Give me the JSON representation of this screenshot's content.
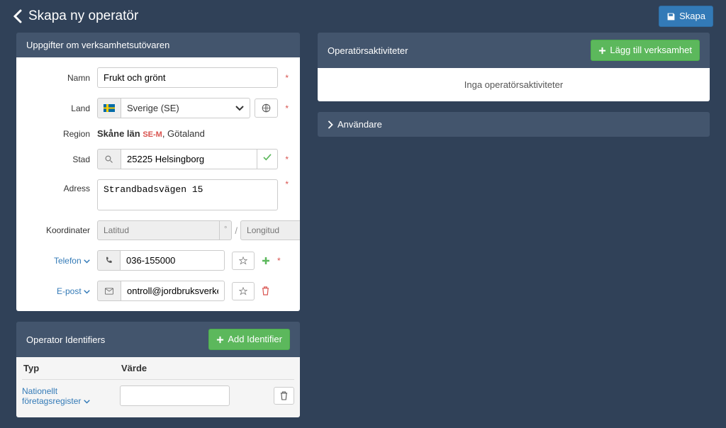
{
  "pageTitle": "Skapa ny operatör",
  "createBtn": "Skapa",
  "detailsPanel": {
    "title": "Uppgifter om verksamhetsutövaren",
    "labels": {
      "name": "Namn",
      "country": "Land",
      "region": "Region",
      "city": "Stad",
      "address": "Adress",
      "coords": "Koordinater",
      "phone": "Telefon",
      "email": "E-post"
    },
    "values": {
      "name": "Frukt och grönt",
      "country": "Sverige (SE)",
      "region_main": "Skåne län",
      "region_code": "SE-M",
      "region_extra": ", Götaland",
      "city": "25225 Helsingborg",
      "address": "Strandbadsvägen 15",
      "latPlaceholder": "Latitud",
      "lonPlaceholder": "Longitud",
      "phone": "036-155000",
      "email": "ontroll@jordbruksverket.se"
    }
  },
  "identifiersPanel": {
    "title": "Operator Identifiers",
    "addBtn": "Add Identifier",
    "colType": "Typ",
    "colValue": "Värde",
    "rowTypeLabel": "Nationellt företagsregister"
  },
  "activitiesPanel": {
    "title": "Operatörsaktiviteter",
    "addBtn": "Lägg till verksamhet",
    "emptyText": "Inga operatörsaktiviteter"
  },
  "usersPanel": {
    "title": "Användare"
  }
}
